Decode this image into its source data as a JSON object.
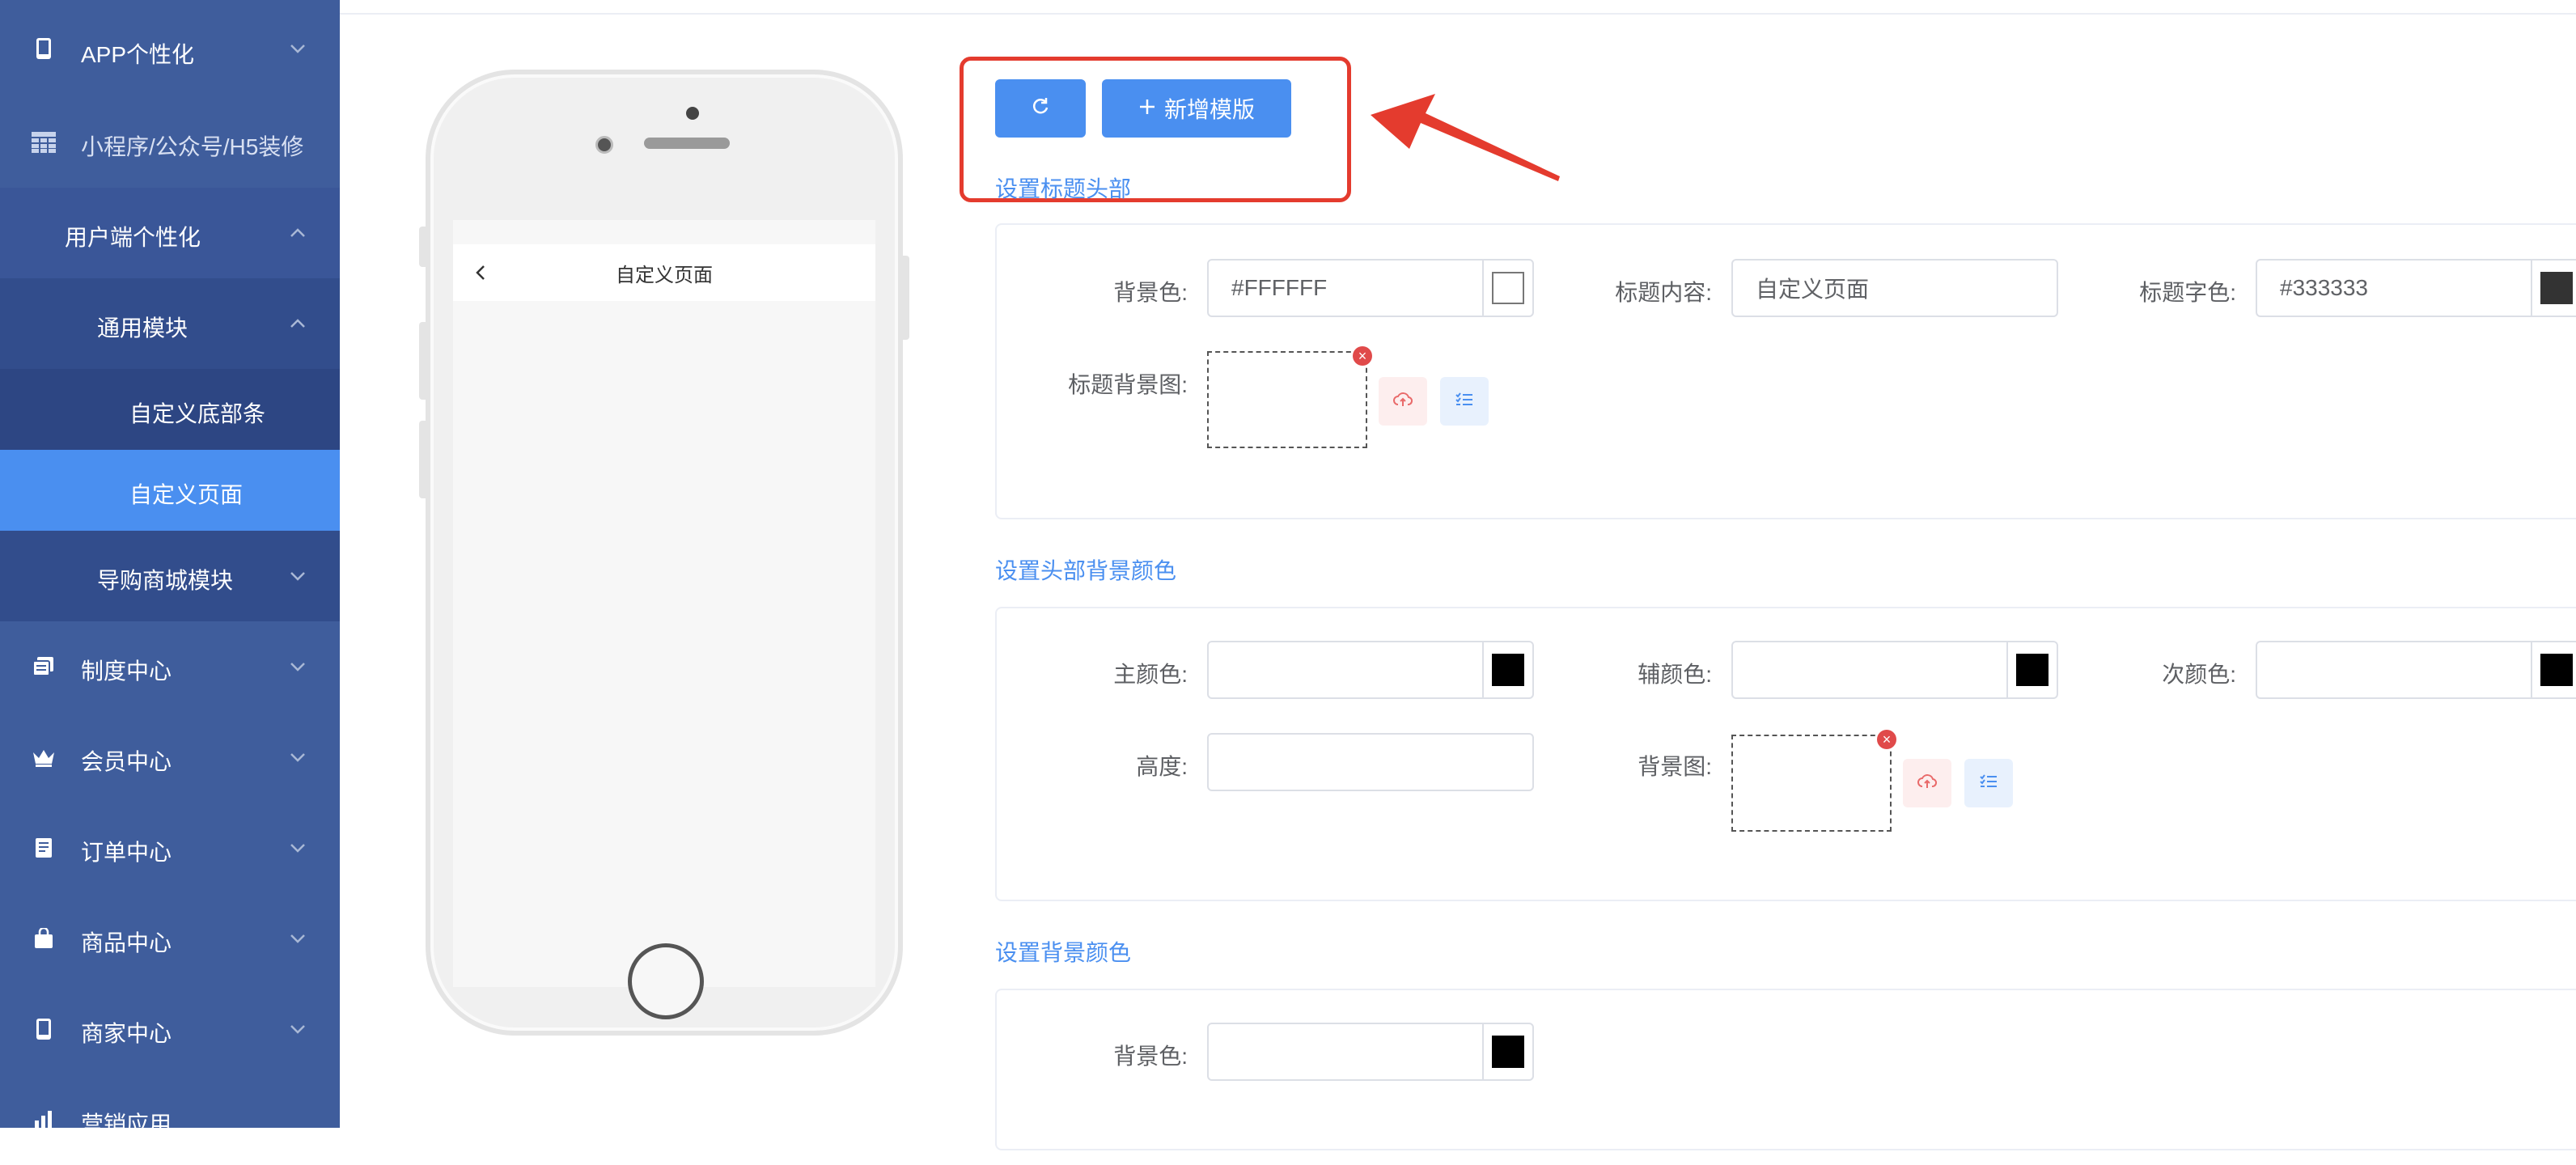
{
  "sidebar": {
    "items": [
      {
        "label": "APP个性化",
        "icon": "phone-icon"
      },
      {
        "label": "小程序/公众号/H5装修",
        "icon": "grid-icon"
      },
      {
        "label": "用户端个性化"
      },
      {
        "label": "通用模块"
      },
      {
        "label": "自定义底部条"
      },
      {
        "label": "自定义页面"
      },
      {
        "label": "导购商城模块"
      },
      {
        "label": "制度中心",
        "icon": "document-stack-icon"
      },
      {
        "label": "会员中心",
        "icon": "crown-icon"
      },
      {
        "label": "订单中心",
        "icon": "order-icon"
      },
      {
        "label": "商品中心",
        "icon": "bag-icon"
      },
      {
        "label": "商家中心",
        "icon": "phone-icon"
      },
      {
        "label": "营销应用",
        "icon": "chart-icon"
      }
    ]
  },
  "phone": {
    "page_title": "自定义页面"
  },
  "toolbar": {
    "add_template_label": "新增模版"
  },
  "sections": {
    "title_header": {
      "title": "设置标题头部",
      "bg_color_label": "背景色:",
      "bg_color_value": "#FFFFFF",
      "title_content_label": "标题内容:",
      "title_content_value": "自定义页面",
      "title_font_color_label": "标题字色:",
      "title_font_color_value": "#333333",
      "title_bg_image_label": "标题背景图:"
    },
    "header_bg": {
      "title": "设置头部背景颜色",
      "primary_color_label": "主颜色:",
      "assist_color_label": "辅颜色:",
      "secondary_color_label": "次颜色:",
      "height_label": "高度:",
      "bg_image_label": "背景图:"
    },
    "page_bg": {
      "title": "设置背景颜色",
      "bg_color_label": "背景色:"
    }
  },
  "colors": {
    "sidebar_bg": "#3f5d9c",
    "sidebar_active": "#4a8ff0",
    "primary": "#4a8ff0",
    "annotation_red": "#e43b2e"
  }
}
